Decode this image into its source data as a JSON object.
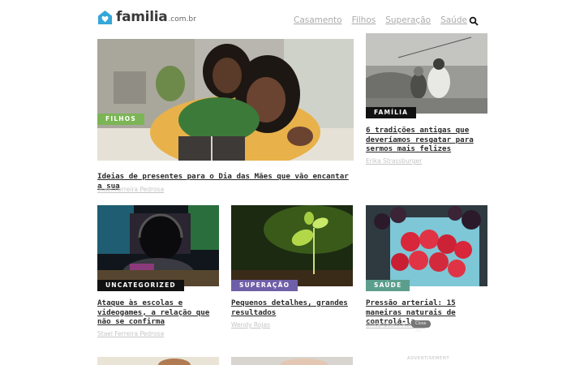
{
  "header": {
    "logo_word": "familia",
    "logo_tld": ".com.br",
    "nav": [
      "Casamento",
      "Filhos",
      "Superação",
      "Saúde"
    ],
    "search_icon": "search-icon"
  },
  "colors": {
    "green_tag": "#7cb555",
    "black_tag": "#111111",
    "purple_tag": "#6f5fa8",
    "teal_tag": "#5b9e8c"
  },
  "articles": [
    {
      "tag": "FILHOS",
      "title": "Ideias de presentes para o Dia das Mães que vão encantar a sua",
      "author": "Stael Ferreira Pedrosa"
    },
    {
      "tag": "FAMÍLIA",
      "title": "6 tradições antigas que deveríamos resgatar para sermos mais felizes",
      "author": "Erika Strassburger"
    },
    {
      "tag": "UNCATEGORIZED",
      "title": "Ataque às escolas e videogames, a relação que não se confirma",
      "author": "Stael Ferreira Pedrosa"
    },
    {
      "tag": "SUPERAÇÃO",
      "title": "Pequenos detalhes, grandes resultados",
      "author": "Wendy Rojas"
    },
    {
      "tag": "SAÚDE",
      "title": "Pressão arterial: 15 maneiras naturais de controlá-la",
      "author": "Erika Otero Romero"
    }
  ],
  "tooltip": "Close Ad",
  "advertisement": "ADVERTISEMENT"
}
